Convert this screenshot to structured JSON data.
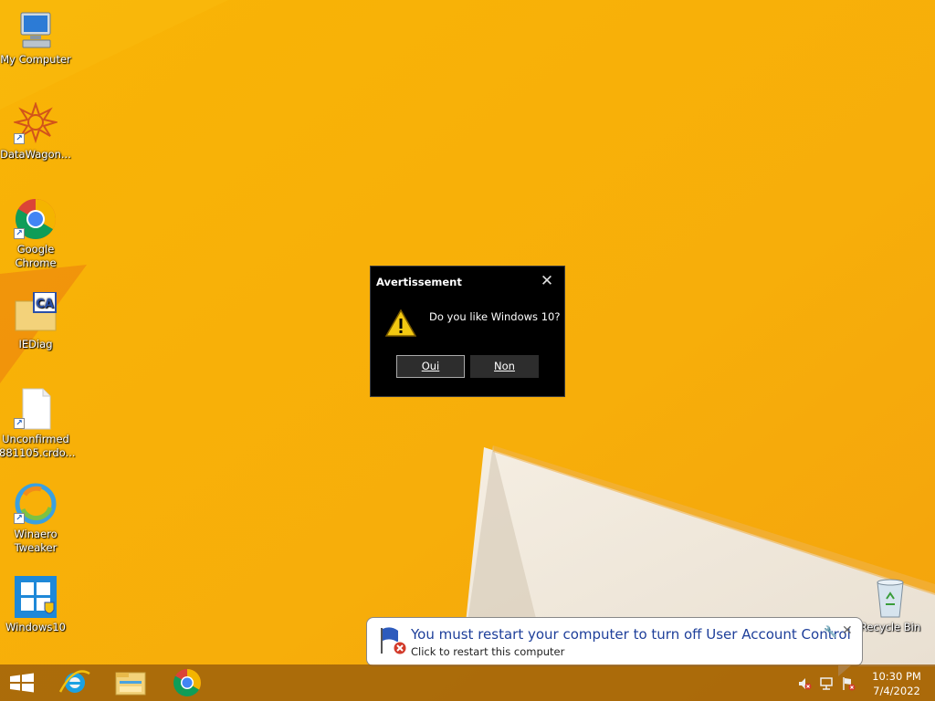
{
  "desktop": {
    "icons": [
      {
        "label": "My Computer",
        "icon": "computer-icon"
      },
      {
        "label": "DataWagon...",
        "icon": "datawagon-icon"
      },
      {
        "label": "Google\nChrome",
        "icon": "chrome-icon"
      },
      {
        "label": "IEDiag",
        "icon": "iediag-folder-icon"
      },
      {
        "label": "Unconfirmed\n881105.crdo...",
        "icon": "file-icon"
      },
      {
        "label": "Winaero\nTweaker",
        "icon": "winaero-icon"
      },
      {
        "label": "Windows10",
        "icon": "windows10-icon"
      },
      {
        "label": "Recycle Bin",
        "icon": "recycle-bin-icon"
      }
    ]
  },
  "dialog": {
    "title": "Avertissement",
    "message": "Do you like Windows 10?",
    "yes_label": "Oui",
    "no_label": "Non",
    "close_glyph": "✕"
  },
  "balloon": {
    "title": "You must restart your computer to turn off User Account Control",
    "subtitle": "Click to restart this computer",
    "close_glyph": "✕",
    "options_glyph": "🔧"
  },
  "taskbar": {
    "pinned": [
      "start-button",
      "internet-explorer-icon",
      "file-explorer-icon",
      "chrome-icon"
    ],
    "clock_time": "10:30 PM",
    "clock_date": "7/4/2022"
  },
  "colors": {
    "wallpaper": "#f7b30a",
    "balloon_title": "#1e3f9a",
    "dialog_bg": "#000000"
  }
}
